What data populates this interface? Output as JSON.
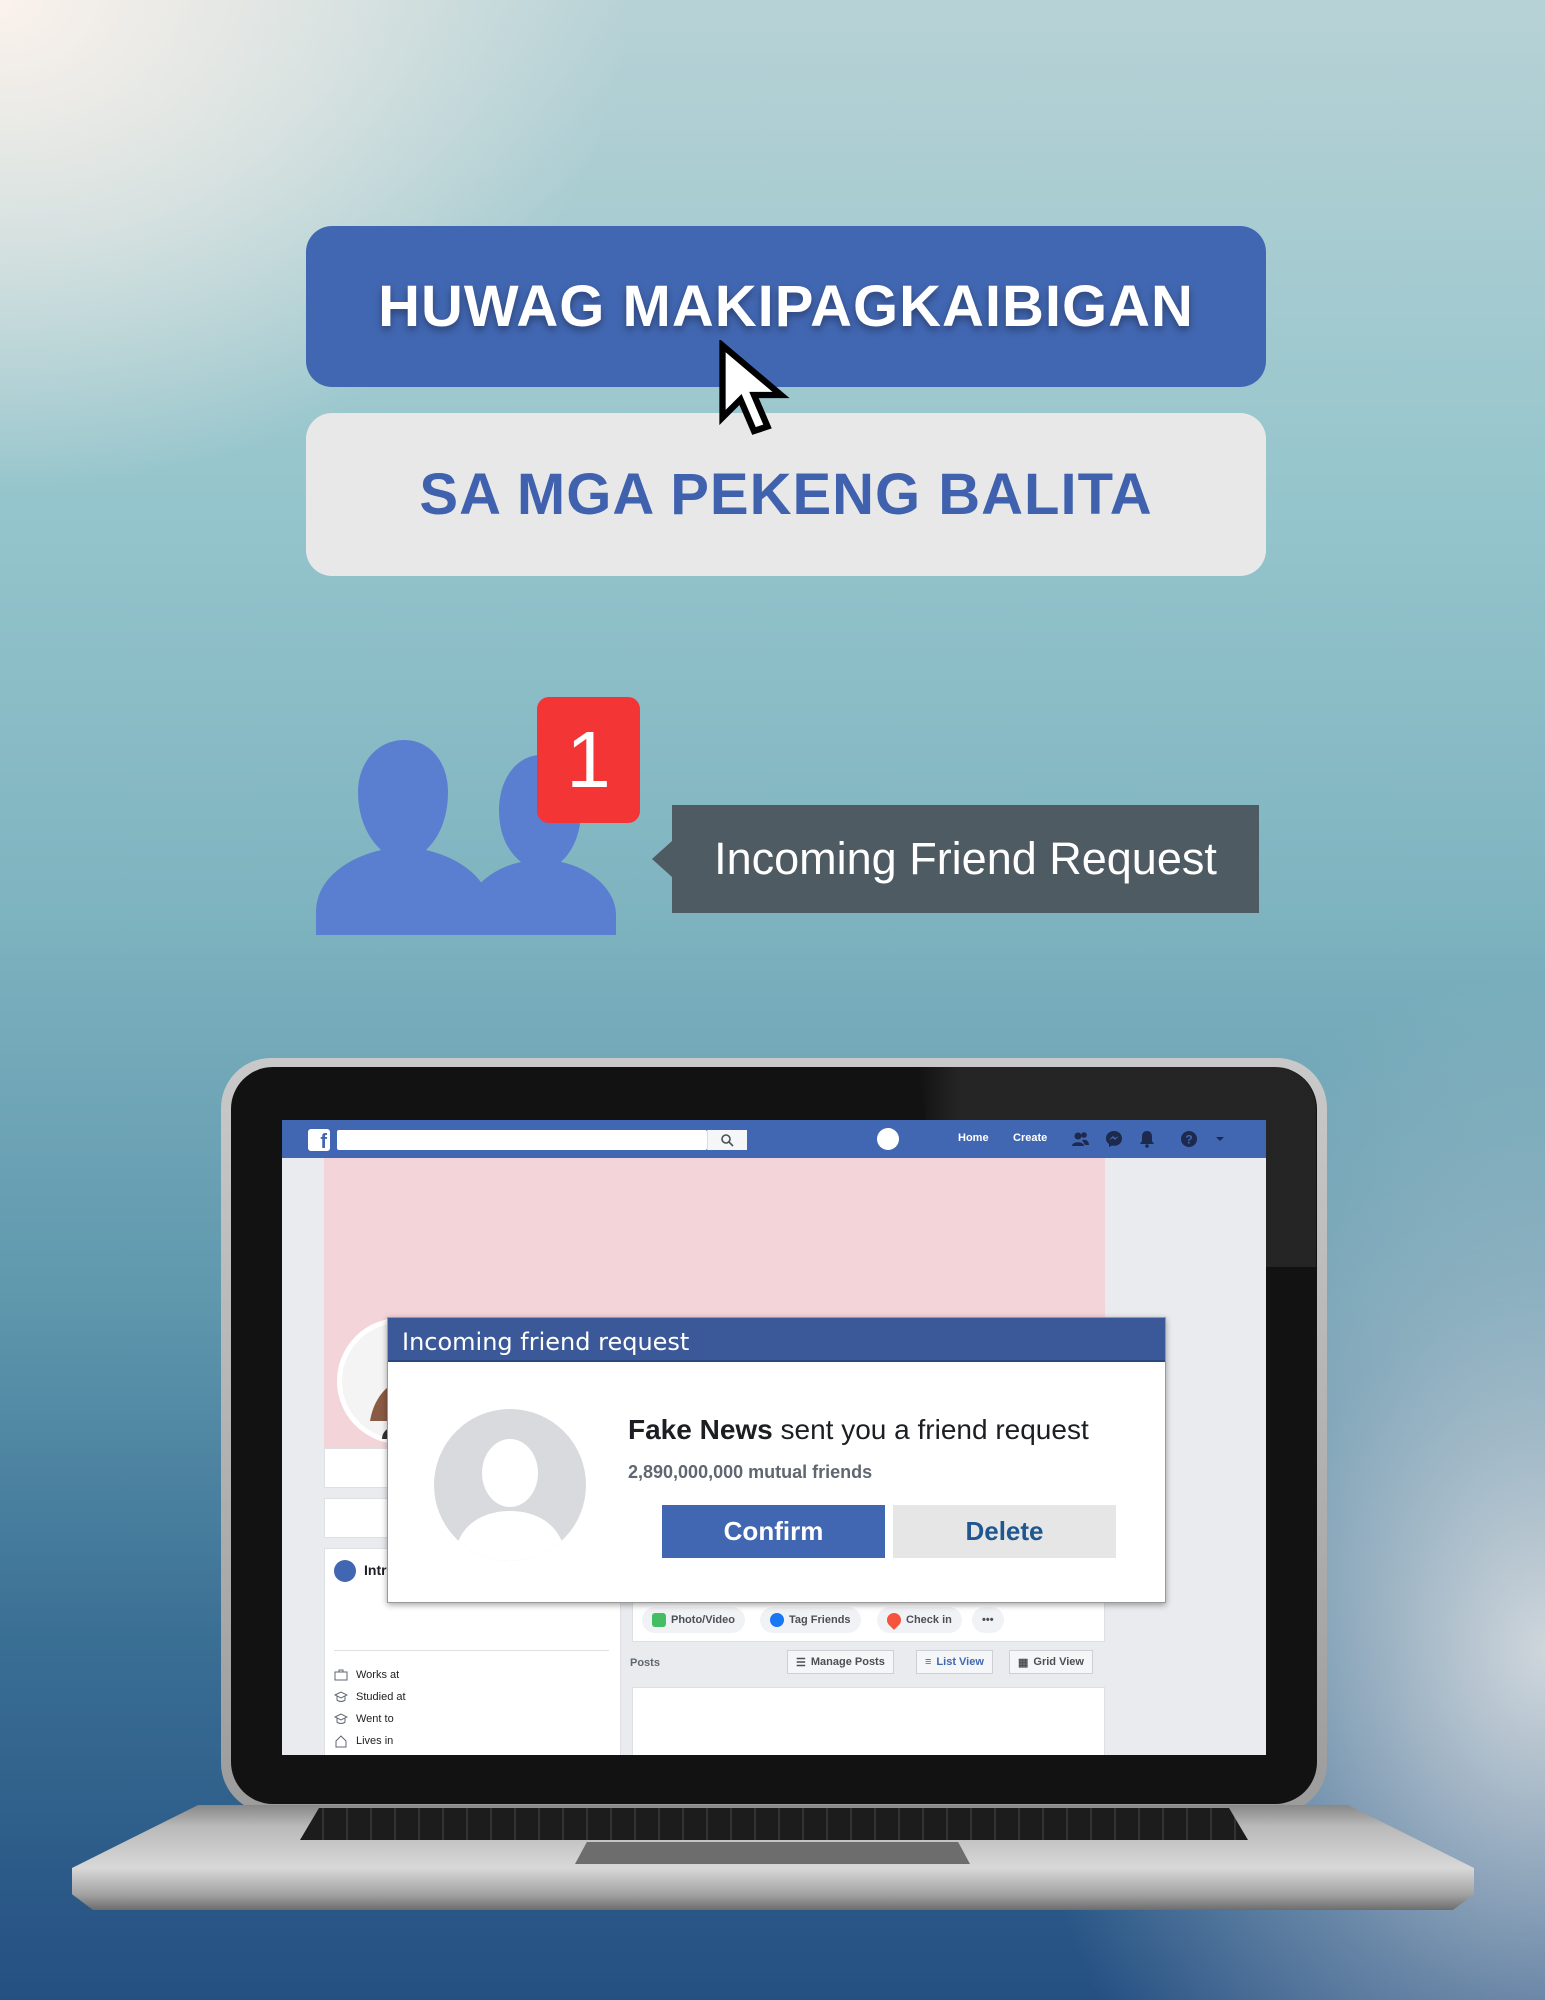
{
  "headline": {
    "line1": "HUWAG MAKIPAGKAIBIGAN",
    "line2": "SA MGA PEKENG BALITA"
  },
  "notification": {
    "badge_count": "1",
    "tooltip": "Incoming Friend Request"
  },
  "facebook": {
    "topbar": {
      "home": "Home",
      "create": "Create",
      "icons": [
        "friends-icon",
        "messenger-icon",
        "bell-icon",
        "help-icon",
        "dropdown-icon"
      ]
    },
    "intro": {
      "label": "Intro",
      "rows": [
        "Works at",
        "Studied at",
        "Went to",
        "Lives in"
      ]
    },
    "composer": {
      "photo_video": "Photo/Video",
      "tag_friends": "Tag Friends",
      "check_in": "Check in",
      "more": "•••"
    },
    "posts": {
      "label": "Posts",
      "manage": "Manage Posts",
      "list_view": "List View",
      "grid_view": "Grid View"
    },
    "dialog": {
      "title": "Incoming friend request",
      "sender": "Fake News",
      "message": " sent you a friend request",
      "mutual": "2,890,000,000 mutual friends",
      "confirm": "Confirm",
      "delete": "Delete"
    }
  },
  "colors": {
    "facebook_blue": "#4267b2",
    "badge_red": "#f33535",
    "tooltip_grey": "#4f5b62"
  }
}
